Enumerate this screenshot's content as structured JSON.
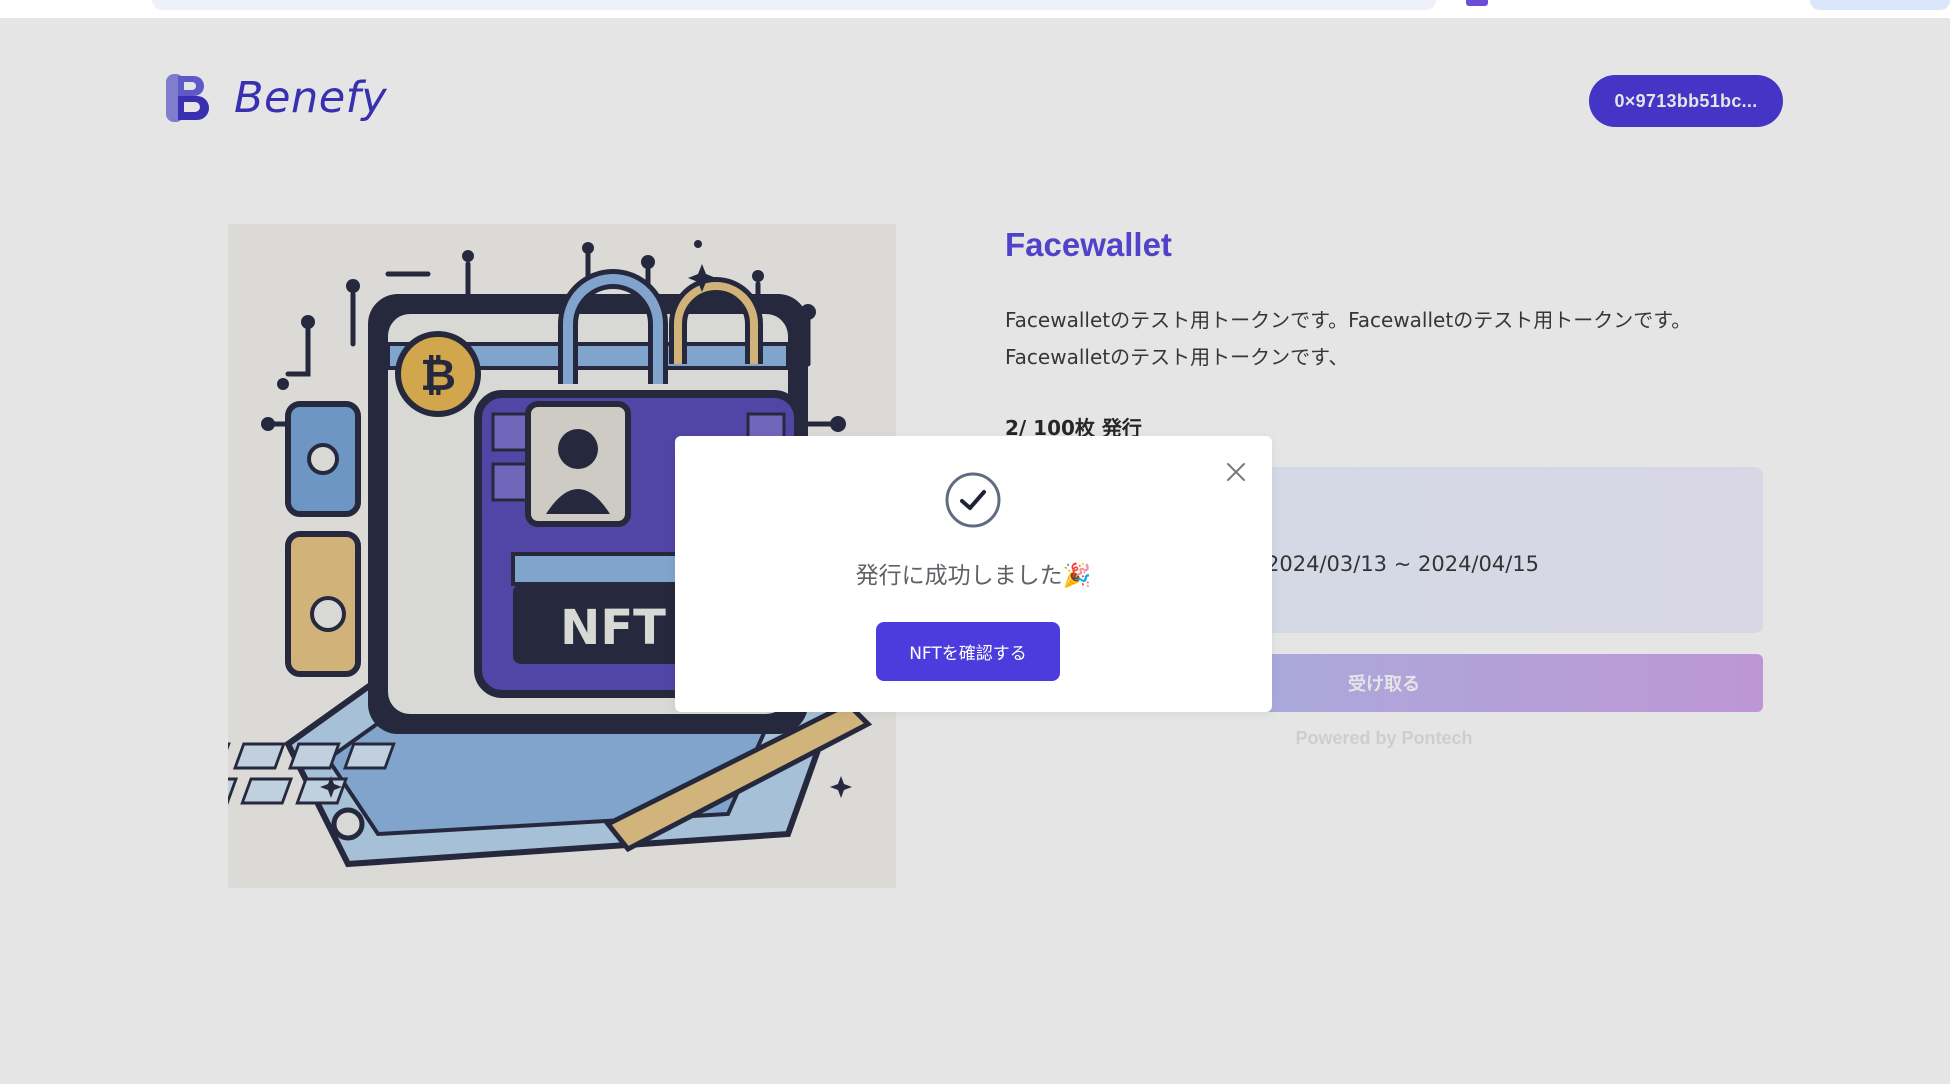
{
  "header": {
    "logo_text": "Benefy",
    "wallet_address": "0×9713bb51bc..."
  },
  "nft": {
    "image_label": "NFT",
    "title": "Facewallet",
    "description": "Facewalletのテスト用トークンです。Facewalletのテスト用トークンです。Facewalletのテスト用トークンです、",
    "supply": "2/ 100枚 発行",
    "period": "2024/03/13 ~ 2024/04/15",
    "claim_label": "受け取る",
    "powered_by": "Powered by Pontech"
  },
  "modal": {
    "message": "発行に成功しました🎉",
    "confirm_label": "NFTを確認する"
  },
  "icons": {
    "logo": "benefy-logo-icon",
    "close": "close-icon",
    "success": "check-circle-icon"
  },
  "colors": {
    "brand": "#4c3bdd",
    "title": "#5a4be0"
  }
}
